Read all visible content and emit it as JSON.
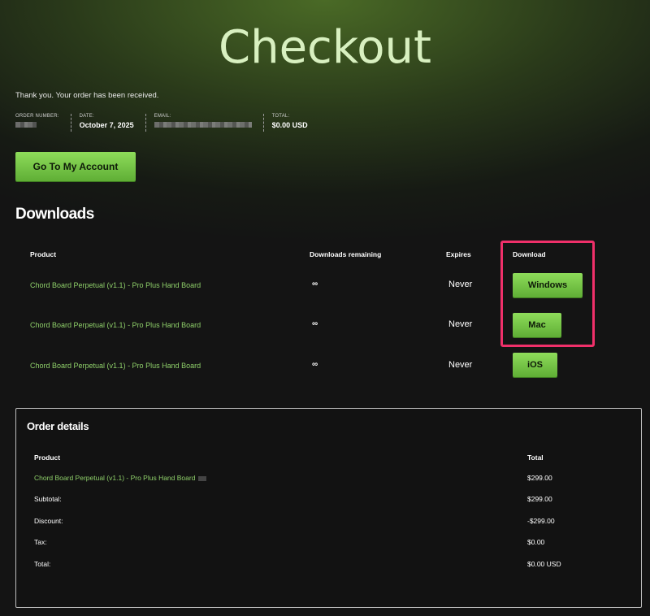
{
  "page": {
    "title": "Checkout"
  },
  "order": {
    "thanks": "Thank you. Your order has been received.",
    "labels": {
      "number": "ORDER NUMBER:",
      "date": "DATE:",
      "email": "EMAIL:",
      "total": "TOTAL:"
    },
    "date": "October 7, 2025",
    "total": "$0.00 USD"
  },
  "account_button": "Go To My Account",
  "downloads": {
    "heading": "Downloads",
    "headers": {
      "product": "Product",
      "remaining": "Downloads remaining",
      "expires": "Expires",
      "download": "Download"
    },
    "rows": [
      {
        "product": "Chord Board Perpetual (v1.1) - Pro Plus Hand Board",
        "remaining": "∞",
        "expires": "Never",
        "button": "Windows"
      },
      {
        "product": "Chord Board Perpetual (v1.1) - Pro Plus Hand Board",
        "remaining": "∞",
        "expires": "Never",
        "button": "Mac"
      },
      {
        "product": "Chord Board Perpetual (v1.1) - Pro Plus Hand Board",
        "remaining": "∞",
        "expires": "Never",
        "button": "iOS"
      }
    ],
    "highlight_color": "#f0306a"
  },
  "order_details": {
    "heading": "Order details",
    "headers": {
      "product": "Product",
      "total": "Total"
    },
    "item": {
      "product": "Chord Board Perpetual (v1.1) - Pro Plus Hand Board",
      "total": "$299.00"
    },
    "rows": [
      {
        "label": "Subtotal:",
        "value": "$299.00"
      },
      {
        "label": "Discount:",
        "value": "-$299.00"
      },
      {
        "label": "Tax:",
        "value": "$0.00"
      },
      {
        "label": "Total:",
        "value": "$0.00 USD"
      }
    ]
  },
  "colors": {
    "accent_green": "#7cc84a",
    "link_green": "#8fd06a",
    "title_green": "#d8f0c0"
  }
}
